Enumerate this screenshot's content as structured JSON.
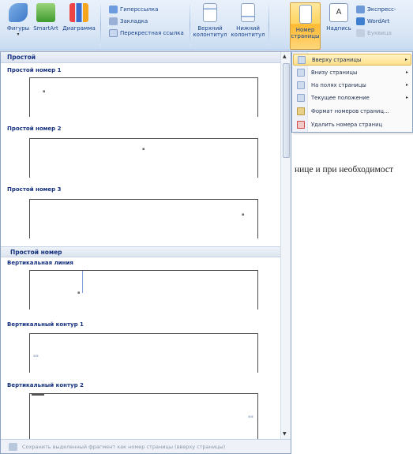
{
  "ribbon": {
    "shapes": {
      "label": "Фигуры"
    },
    "smartart": {
      "label": "SmartArt"
    },
    "chart": {
      "label": "Диаграмма"
    },
    "hyperlink": "Гиперссылка",
    "bookmark": "Закладка",
    "crossref": "Перекрестная ссылка",
    "header": {
      "label1": "Верхний",
      "label2": "колонтитул"
    },
    "footer": {
      "label1": "Нижний",
      "label2": "колонтитул"
    },
    "page_number": {
      "label1": "Номер",
      "label2": "страницы"
    },
    "textbox": {
      "label": "Надпись"
    },
    "quickparts": "Экспресс-",
    "wordart": "WordArt",
    "dropcap": "Буквица"
  },
  "gallery": {
    "header": "Простой",
    "items": [
      {
        "label": "Простой номер 1"
      },
      {
        "label": "Простой номер 2"
      },
      {
        "label": "Простой номер 3"
      }
    ],
    "section2": "Простой номер",
    "items2": [
      {
        "label": "Вертикальная линия"
      },
      {
        "label": "Вертикальный контур 1"
      },
      {
        "label": "Вертикальный контур 2"
      }
    ],
    "footer": "Сохранить выделенный фрагмент как номер страницы (вверху страницы)"
  },
  "menu": {
    "items": [
      {
        "label": "Вверху страницы",
        "submenu": true,
        "highlighted": true
      },
      {
        "label": "Внизу страницы",
        "submenu": true
      },
      {
        "label": "На полях страницы",
        "submenu": true
      },
      {
        "label": "Текущее положение",
        "submenu": true
      },
      {
        "label": "Формат номеров страниц...",
        "submenu": false
      },
      {
        "label": "Удалить номера страниц",
        "submenu": false
      }
    ]
  },
  "document": {
    "text": "нице и при необходимост"
  },
  "colors": {
    "ribbon_bg": "#dbe7f6",
    "accent_text": "#15428b",
    "highlight": "#ffd35e"
  }
}
